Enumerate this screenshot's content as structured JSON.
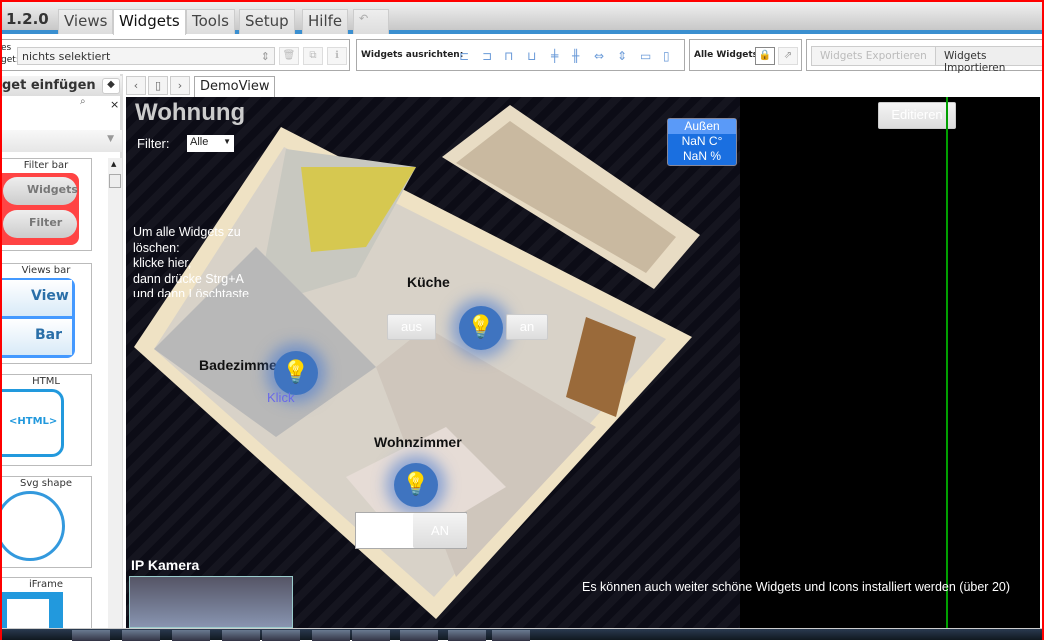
{
  "menu": {
    "version": "1.2.0",
    "tabs": [
      "Views",
      "Widgets",
      "Tools",
      "Setup",
      "Hilfe"
    ],
    "active": "Widgets",
    "undo_icon": "undo-icon"
  },
  "toolbar": {
    "selected_label_1": "es",
    "selected_label_2": "get:",
    "widget_select": "nichts selektiert",
    "align_label": "Widgets ausrichten:",
    "all_label": "Alle Widgets:",
    "export": "Widgets Exportieren",
    "import": "Widgets Importieren"
  },
  "left": {
    "header": "get einfügen",
    "cards": [
      {
        "title": "Filter bar",
        "b1": "Widgets",
        "b2": "Filter"
      },
      {
        "title": "Views bar",
        "b1": "View",
        "b2": "Bar"
      },
      {
        "title": "HTML",
        "body": "<HTML>"
      },
      {
        "title": "Svg shape"
      },
      {
        "title": "iFrame"
      }
    ]
  },
  "view_tab": "DemoView",
  "canvas": {
    "title": "Wohnung",
    "filter_label": "Filter:",
    "filter_value": "Alle",
    "info_lines": [
      "Um alle Widgets zu",
      "löschen:",
      "klicke hier,",
      "dann drücke Strg+A",
      "und dann Löschtaste"
    ],
    "outside": {
      "title": "Außen",
      "temp": "NaN C°",
      "hum": "NaN %"
    },
    "edit": "Editieren",
    "kitchen": {
      "label": "Küche",
      "off": "aus",
      "on": "an"
    },
    "bath": {
      "label": "Badezimmer",
      "click": "Klick"
    },
    "living": {
      "label": "Wohnzimmer",
      "switch": "AN"
    },
    "camera": "IP Kamera",
    "footer": "Es können auch weiter schöne Widgets und Icons installiert werden (über 20)"
  },
  "colors": {
    "accent": "#3a8fd0",
    "bulb": "#3f74c0",
    "outside_box": "#1a6fe0",
    "guide": "#00a000"
  }
}
